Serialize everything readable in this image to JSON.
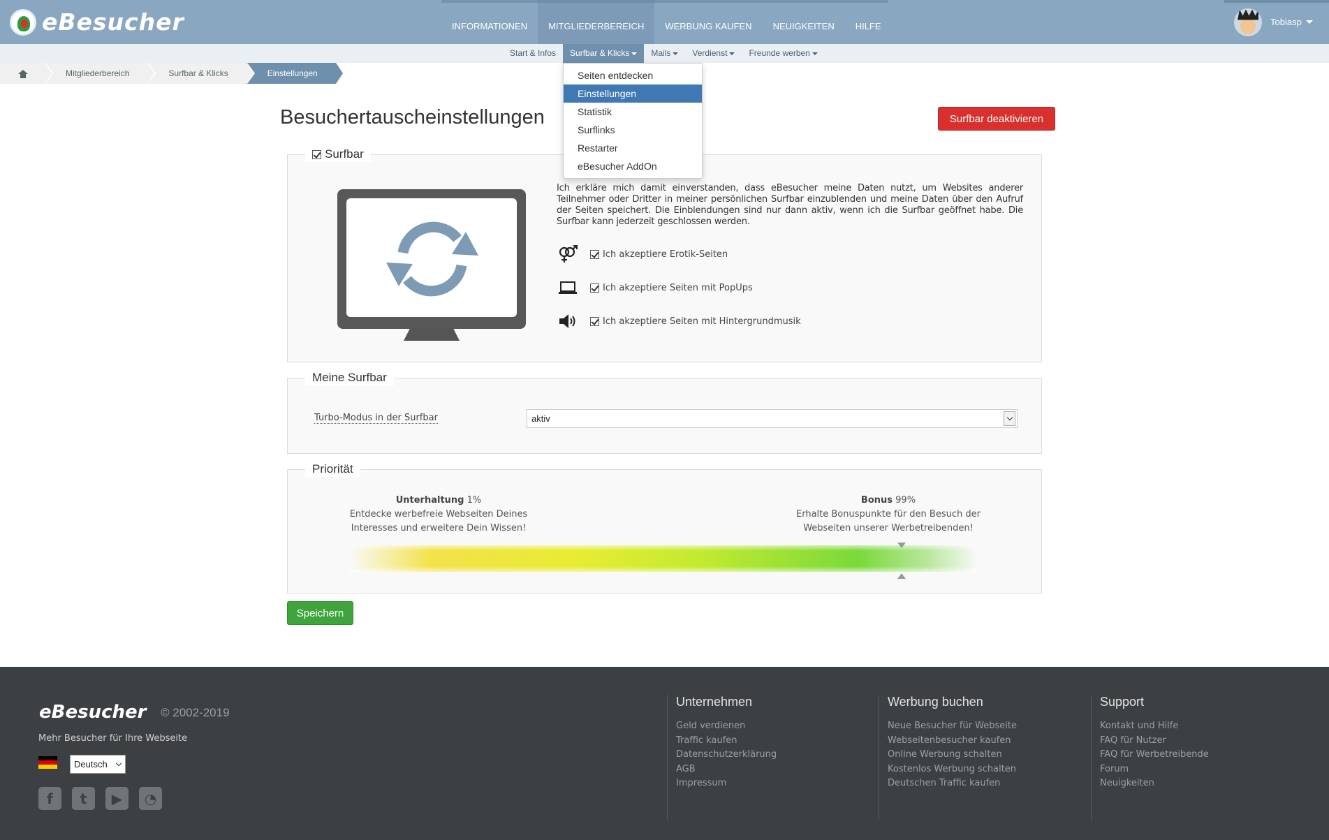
{
  "app": {
    "logo_text": "eBesucher"
  },
  "main_nav": [
    {
      "label": "INFORMATIONEN",
      "active": false
    },
    {
      "label": "MITGLIEDERBEREICH",
      "active": true
    },
    {
      "label": "WERBUNG KAUFEN",
      "active": false
    },
    {
      "label": "NEUIGKEITEN",
      "active": false
    },
    {
      "label": "HILFE",
      "active": false
    }
  ],
  "user": {
    "name": "Tobiasp"
  },
  "sub_nav": [
    {
      "label": "Start & Infos",
      "dropdown": false,
      "active": false
    },
    {
      "label": "Surfbar & Klicks",
      "dropdown": true,
      "active": true
    },
    {
      "label": "Mails",
      "dropdown": true,
      "active": false
    },
    {
      "label": "Verdienst",
      "dropdown": true,
      "active": false
    },
    {
      "label": "Freunde werben",
      "dropdown": true,
      "active": false
    }
  ],
  "dropdown_menu": [
    {
      "label": "Seiten entdecken",
      "active": false
    },
    {
      "label": "Einstellungen",
      "active": true
    },
    {
      "label": "Statistik",
      "active": false
    },
    {
      "label": "Surflinks",
      "active": false
    },
    {
      "label": "Restarter",
      "active": false
    },
    {
      "label": "eBesucher AddOn",
      "active": false
    }
  ],
  "breadcrumb": [
    "Mitgliederbereich",
    "Surfbar & Klicks",
    "Einstellungen"
  ],
  "page": {
    "title": "Besuchertauscheinstellungen",
    "deactivate_button": "Surfbar deaktivieren"
  },
  "surfbar": {
    "legend": "Surfbar",
    "enabled": true,
    "consent_text": "Ich erkläre mich damit einverstanden, dass eBesucher meine Daten nutzt, um Websites anderer Teilnehmer oder Dritter in meiner persönlichen Surfbar einzublenden und meine Daten über den Aufruf der Seiten speichert. Die Einblendungen sind nur dann aktiv, wenn ich die Surfbar geöffnet habe. Die Surfbar kann jederzeit geschlossen werden.",
    "options": [
      {
        "label": "Ich akzeptiere Erotik-Seiten",
        "icon": "gender-icon",
        "checked": true
      },
      {
        "label": "Ich akzeptiere Seiten mit PopUps",
        "icon": "laptop-icon",
        "checked": true
      },
      {
        "label": "Ich akzeptiere Seiten mit Hintergrundmusik",
        "icon": "speaker-icon",
        "checked": true
      }
    ]
  },
  "meine_surfbar": {
    "legend": "Meine Surfbar",
    "turbo_label": "Turbo-Modus in der Surfbar",
    "turbo_value": "aktiv"
  },
  "prioritaet": {
    "legend": "Priorität",
    "left": {
      "title": "Unterhaltung",
      "percent": "1%",
      "description": "Entdecke werbefreie Webseiten Deines Interesses und erweitere Dein Wissen!"
    },
    "right": {
      "title": "Bonus",
      "percent": "99%",
      "description": "Erhalte Bonuspunkte für den Besuch der Webseiten unserer Werbetreibenden!"
    },
    "slider_value_percent": 88
  },
  "save_button": "Speichern",
  "footer": {
    "logo_text": "eBesucher",
    "copyright": "© 2002-2019",
    "tagline": "Mehr Besucher für Ihre Webseite",
    "language": "Deutsch",
    "social": [
      {
        "icon": "facebook-icon",
        "glyph": "f"
      },
      {
        "icon": "twitter-icon",
        "glyph": "t"
      },
      {
        "icon": "youtube-icon",
        "glyph": "▶"
      },
      {
        "icon": "rss-icon",
        "glyph": "◔"
      }
    ],
    "columns": [
      {
        "title": "Unternehmen",
        "links": [
          "Geld verdienen",
          "Traffic kaufen",
          "Datenschutzerklärung",
          "AGB",
          "Impressum"
        ]
      },
      {
        "title": "Werbung buchen",
        "links": [
          "Neue Besucher für Webseite",
          "Webseitenbesucher kaufen",
          "Online Werbung schalten",
          "Kostenlos Werbung schalten",
          "Deutschen Traffic kaufen"
        ]
      },
      {
        "title": "Support",
        "links": [
          "Kontakt und Hilfe",
          "FAQ für Nutzer",
          "FAQ für Werbetreibende",
          "Forum",
          "Neuigkeiten"
        ]
      }
    ]
  },
  "colors": {
    "accent": "#8aa7c1",
    "active_menu": "#3f78b3",
    "danger": "#d9302d",
    "success": "#3ea43b",
    "footer_bg": "#3c4043"
  }
}
